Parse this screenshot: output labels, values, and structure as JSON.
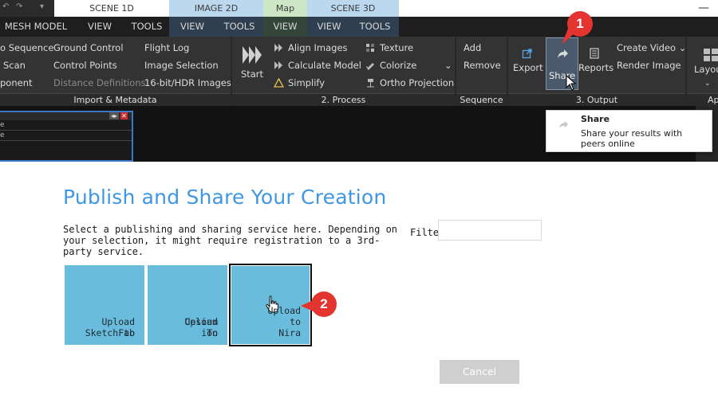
{
  "context_tabs": {
    "scene1d": "SCENE 1D",
    "image2d": "IMAGE 2D",
    "map": "Map",
    "scene3d": "SCENE 3D"
  },
  "tabs": [
    "MESH MODEL",
    "VIEW",
    "TOOLS",
    "VIEW",
    "TOOLS",
    "VIEW",
    "VIEW",
    "TOOLS"
  ],
  "ribbon": {
    "import": {
      "col1": [
        "o Sequence",
        "Scan",
        "ponent"
      ],
      "col2": [
        "Ground Control",
        "Control Points",
        "Distance Definitions"
      ],
      "col3": [
        "Flight Log",
        "Image Selection",
        "16-bit/HDR Images"
      ],
      "footer": "Import & Metadata"
    },
    "process": {
      "start": "Start",
      "items": [
        "Align Images",
        "Calculate Model",
        "Simplify",
        "Texture",
        "Colorize",
        "Ortho Projection"
      ],
      "footer": "2. Process"
    },
    "sequence": {
      "items": [
        "Add",
        "Remove"
      ],
      "footer": "Sequence"
    },
    "output": {
      "export": "Export",
      "share": "Share",
      "reports": "Reports",
      "create_video": "Create Video",
      "render_image": "Render Image",
      "footer": "3. Output"
    },
    "layout": {
      "label": "Layou",
      "footer": "App"
    }
  },
  "panel_rows": [
    "e",
    "e"
  ],
  "tooltip": {
    "title": "Share",
    "description": "Share your results with peers online"
  },
  "badges": [
    "1",
    "2"
  ],
  "dialog": {
    "title": "Publish and Share Your Creation",
    "description": "Select a publishing and sharing service here. Depending on your selection, it might require registration to a 3rd-party service.",
    "filter_label": "Filter",
    "filter_value": "",
    "tiles": [
      {
        "line1": "Upload to",
        "line2": "SketchFab"
      },
      {
        "line1": "Upload To",
        "line2": "Cesium ion"
      },
      {
        "line1": "",
        "line2": "Upload to Nira"
      }
    ],
    "cancel_label": "Cancel"
  },
  "colors": {
    "accent": "#3f97e3",
    "tile": "#69bcdc",
    "badge": "#e4342f",
    "ribbon": "#333333"
  }
}
